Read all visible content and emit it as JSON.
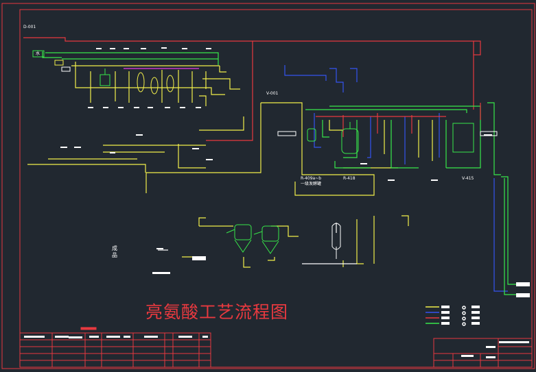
{
  "title": "亮氨酸工艺流程图",
  "vertical_label": "成品",
  "labels": {
    "d001": "D-001",
    "water": "水",
    "v001": "V-001",
    "r409": "R-409a~b",
    "r409_sub": "一级发酵罐",
    "r418": "R-418",
    "v415": "V-415"
  },
  "colors": {
    "background": "#212830",
    "frame": "#e8393f",
    "yellow": "#f3f04a",
    "green": "#38e84a",
    "blue": "#3553f0",
    "magenta": "#e83de8",
    "white": "#ffffff",
    "red": "#e8393f"
  }
}
